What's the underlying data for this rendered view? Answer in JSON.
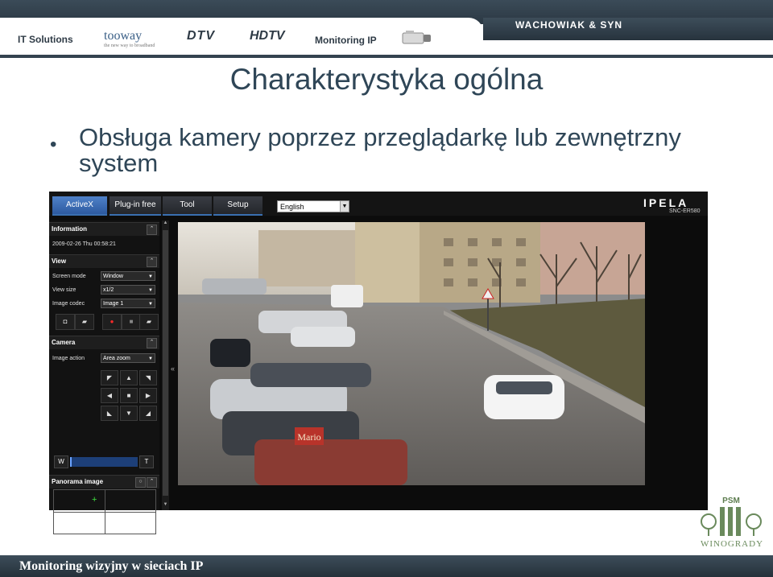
{
  "header": {
    "logos": [
      "IT Solutions",
      "tooway",
      "the new way to broadband",
      "DTV",
      "HDTV",
      "Monitoring IP"
    ],
    "brand": "WACHOWIAK & SYN"
  },
  "slide": {
    "title": "Charakterystyka ogólna",
    "bullet": "Obsługa kamery poprzez przeglądarkę lub zewnętrzny system"
  },
  "camera_ui": {
    "tabs": [
      "ActiveX",
      "Plug-in free",
      "Tool",
      "Setup"
    ],
    "language": "English",
    "brand": "IPELA",
    "model": "SNC-ER580",
    "information": {
      "title": "Information",
      "datetime": "2009-02-26 Thu 00:58:21"
    },
    "view": {
      "title": "View",
      "screen_mode_label": "Screen mode",
      "screen_mode_value": "Window",
      "view_size_label": "View size",
      "view_size_value": "x1/2",
      "image_codec_label": "Image codec",
      "image_codec_value": "Image 1"
    },
    "camera": {
      "title": "Camera",
      "image_action_label": "Image action",
      "image_action_value": "Area zoom",
      "zoom_wide": "W",
      "zoom_tele": "T"
    },
    "panorama": {
      "title": "Panorama image"
    },
    "scene": {
      "sign_text": "Mario"
    }
  },
  "footer": {
    "text": "Monitoring wizyjny w sieciach IP",
    "partner_logo": "PSM",
    "partner": "WINOGRADY"
  },
  "colors": {
    "accent": "#2f4657",
    "header_dark": "#34434f",
    "tab_active": "#3c6cb6"
  }
}
